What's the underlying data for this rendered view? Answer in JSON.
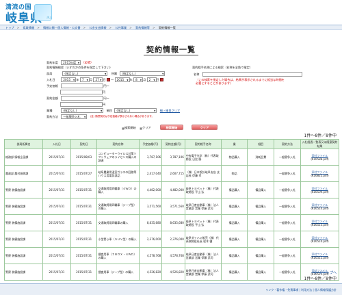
{
  "header": {
    "logo_top": "清流の国",
    "logo_main": "岐阜県",
    "badge_text": "ぎふ"
  },
  "breadcrumb": [
    "トップ",
    "県政情報",
    "情報公開・個人情報・公文書",
    "公金支出情報",
    "公共事業",
    "契約情報等",
    "契約情報一覧"
  ],
  "page_title": "契約情報一覧",
  "form": {
    "year_label": "契約年度",
    "year_value": "2015年度",
    "required": "（必須）",
    "cond_label": "契約情報検索（いずれかの条件を指定して下さい）",
    "dept_label": "部局",
    "dept_value": "(指定なし)",
    "office_label": "所属",
    "office_value": "(指定なし)",
    "nyusatsu_label": "入札日",
    "date_from_y": "2015",
    "date_from_m": "7",
    "date_from_d": "27",
    "date_to_y": "2015",
    "date_to_m": "8",
    "date_to_d": "2",
    "nen": "年",
    "tsuki": "月",
    "nichi": "日",
    "kara": "～",
    "yotei_label": "予定価格",
    "en": "円",
    "keiyaku_label": "契約金額",
    "type_label": "業種",
    "type_value": "(指定なし)",
    "kind_label": "細目",
    "kind_value": "(指定なし)",
    "clear_link": "細・細目クリア",
    "method_label": "契約方法",
    "method_value": "一般競争入札",
    "note": "(注) 随意契約は予定価格が表示されない場合があります。",
    "partner_label": "契約相手名称による検索（名称を全角で指定）",
    "name_label": "名称",
    "warning": "（この検索を指定した場合は、結果が表示されるまでに相当な時間を必要とすることがあります）",
    "search_icon_text": "検索開始",
    "clear_icon_text": "クリア",
    "search_btn": "検索開始",
    "clear_btn": "クリア"
  },
  "count_text": "1件～8件／8件中",
  "table": {
    "headers": [
      "部局所属名",
      "入札日",
      "契約日",
      "契約名称",
      "予定価格(円)",
      "契約金額(円)",
      "契約相手名称",
      "業",
      "細目",
      "契約方法",
      "入札経過一覧表又は随意契約結果"
    ],
    "rows": [
      [
        "総務部 情報企画課",
        "2015/07/31",
        "2015/08/03",
        "コンピューターウイルス対策ソフトウェアのライセンス購入の調達",
        "3,787,106",
        "3,787,106",
        "中央電子光学（株）代表取締役 日比 勝",
        "物品購入",
        "消耗品費",
        "一般競争入札",
        "添付ファイル",
        "(K16588.pdf)"
      ],
      [
        "農政部 農村振興課",
        "2015/07/31",
        "2015/07/27",
        "岐阜農業用温室ガラスの回路等ハウス用電気部品",
        "2,417,040",
        "2,607,715",
        "（株）日本設計岐阜支店 支店長 伊藤 孝",
        "物品",
        "",
        "一般競争入札",
        "添付ファイル",
        "(K16822.pdf)"
      ],
      [
        "警察 装備施設課",
        "2015/07/31",
        "2015/07/31",
        "交通取締用四輪車（４ＷＤ）の購入",
        "4,482,000",
        "4,482,000",
        "岐阜トヨペット（株）代表取締役 平山 弘",
        "備品購入",
        "備品購入",
        "一般競争入札",
        "添付ファイル",
        "(K16509.pdf)"
      ],
      [
        "警察 装備施設課",
        "2015/07/31",
        "2015/07/31",
        "交通取締用四輪車（ジープ型）の購入",
        "3,571,560",
        "3,571,560",
        "岐阜日産自動車（株）法人営業部 営業 伊藤 武司",
        "備品購入",
        "備品購入",
        "一般競争入札",
        "添付ファイル",
        "(K16514.pdf)"
      ],
      [
        "警察 装備施設課",
        "2015/07/31",
        "2015/07/31",
        "交通取締用四輪車の購入",
        "8,635,680",
        "8,635,680",
        "岐阜トヨペット（株）代表取締役 平山 弘",
        "備品購入",
        "備品購入",
        "一般競争入札",
        "添付ファイル",
        "(K16513.pdf)"
      ],
      [
        "警察 装備施設課",
        "2015/07/31",
        "2015/07/31",
        "小型警ら車（ＳＵＶ型）の購入",
        "2,376,000",
        "2,376,000",
        "岐阜ダイハツ販売（株）代表取締役社長 松木 健",
        "備品購入",
        "備品購入",
        "一般競争入札",
        "添付ファイル",
        "(K16510.pdf)"
      ],
      [
        "警察 装備施設課",
        "2015/07/31",
        "2015/07/31",
        "捜査用車（ＩＢＯＸ・４ＷＤ）の購入",
        "4,578,768",
        "4,578,768",
        "岐阜日産自動車（株）法人営業部 営業 伊藤 武司",
        "備品購入",
        "備品購入",
        "一般競争入札",
        "添付ファイル",
        "(K16512.pdf)"
      ],
      [
        "警察 装備施設課",
        "2015/07/31",
        "2015/07/31",
        "捜査用車（ジープ型）の購入",
        "4,526,820",
        "4,526,820",
        "岐阜日産自動車（株）法人営業部 営業 伊藤 武司",
        "備品購入",
        "備品購入",
        "一般競争入札",
        "添付ファイル",
        "(K16515.pdf)"
      ]
    ]
  },
  "count_text_bottom": "1件～8件／8件中",
  "page_top": "ページトップへ",
  "footer_links": "リンク・著作権・免責事項 | 利用方法 | 個人情報保護方針"
}
